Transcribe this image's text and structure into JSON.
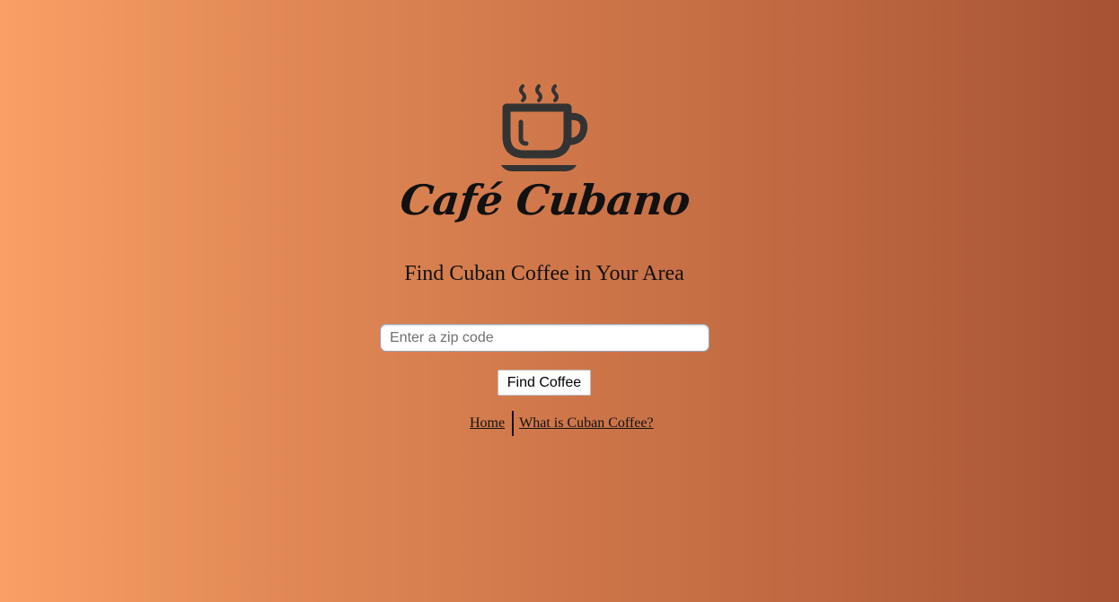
{
  "logo": {
    "icon": "coffee-cup-icon",
    "color": "#333333"
  },
  "brand": {
    "name": "Café Cubano"
  },
  "hero": {
    "subtitle": "Find Cuban Coffee in Your Area"
  },
  "search": {
    "placeholder": "Enter a zip code",
    "value": "",
    "button_label": "Find Coffee"
  },
  "nav": {
    "links": [
      {
        "label": "Home"
      },
      {
        "label": "What is Cuban Coffee?"
      }
    ]
  },
  "colors": {
    "gradient_start": "#f9a066",
    "gradient_end": "#a65233",
    "text": "#111111"
  }
}
